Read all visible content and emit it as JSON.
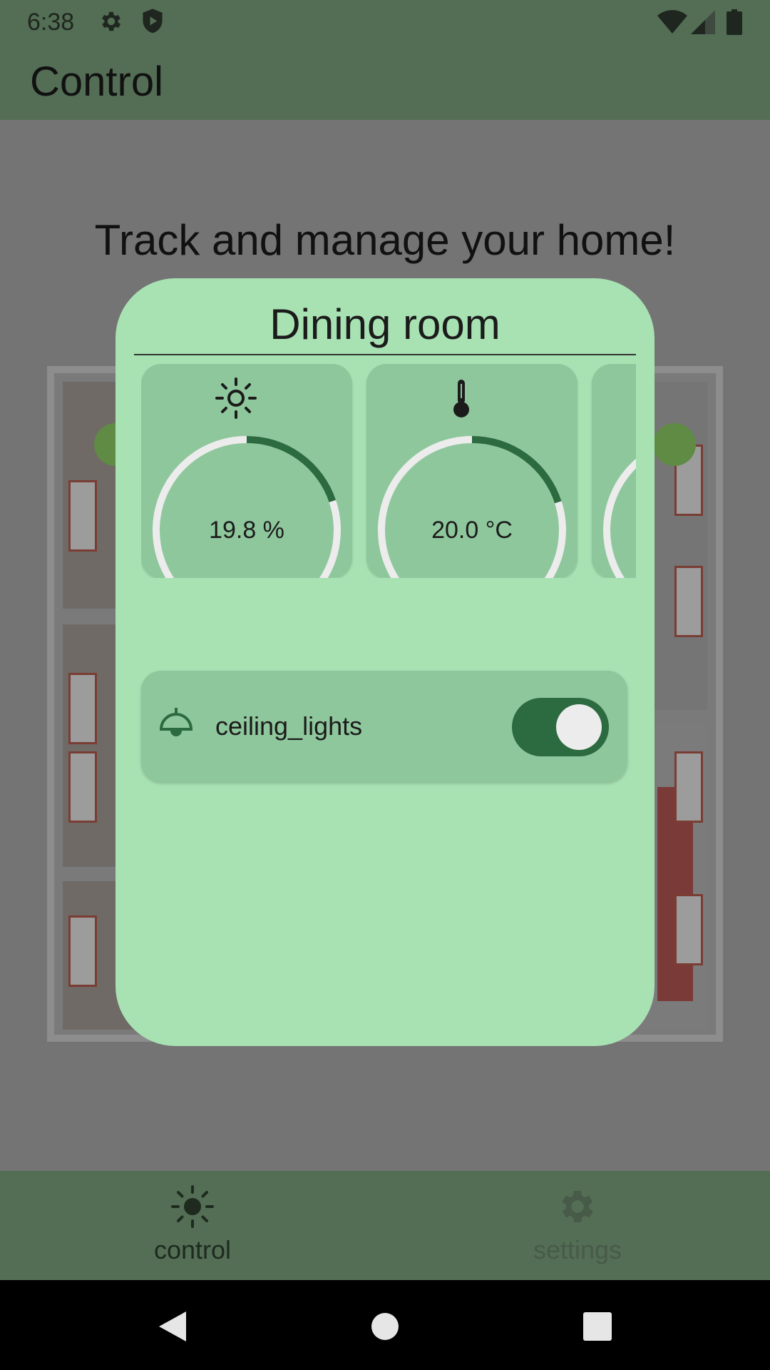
{
  "status_bar": {
    "time": "6:38",
    "icons": [
      "gear-icon",
      "shield-icon",
      "wifi-icon",
      "signal-icon",
      "battery-icon"
    ]
  },
  "app_bar": {
    "title": "Control"
  },
  "main": {
    "headline": "Track and manage your home!"
  },
  "dialog": {
    "title": "Dining room",
    "sensors": [
      {
        "icon": "sun-icon",
        "value": "19.8 %",
        "level": 0.198
      },
      {
        "icon": "thermometer-icon",
        "value": "20.0 °C",
        "level": 0.2
      },
      {
        "icon": "unknown",
        "value": "",
        "level": 0.2
      }
    ],
    "devices": [
      {
        "icon": "ceiling-lamp-icon",
        "label": "ceiling_lights",
        "on": true
      }
    ]
  },
  "bottom_nav": {
    "items": [
      {
        "label": "control",
        "icon": "sun-icon",
        "selected": true
      },
      {
        "label": "settings",
        "icon": "gear-icon",
        "selected": false
      }
    ]
  },
  "colors": {
    "accent": "#2c6a3f",
    "dialog_bg": "#a8e2b3",
    "card_bg": "#8fc79d",
    "bar_bg": "#536e55",
    "scrim": "#747474"
  }
}
